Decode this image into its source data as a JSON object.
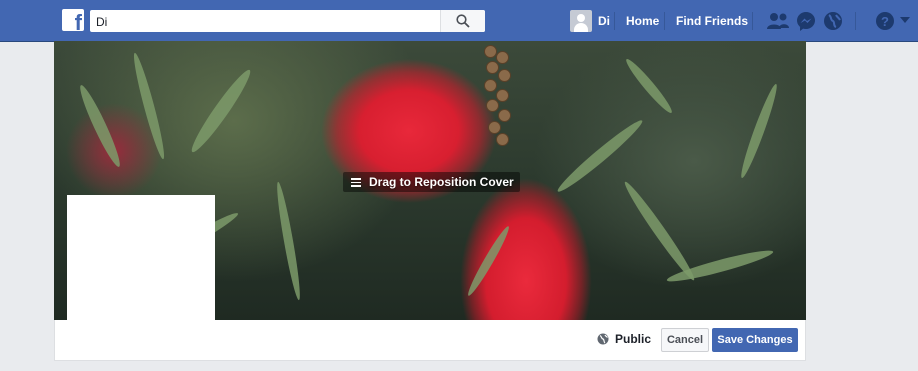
{
  "header": {
    "logo_letter": "f",
    "search": {
      "value": "Di",
      "placeholder": "Search"
    },
    "profile_name": "Di",
    "nav": {
      "home": "Home",
      "find_friends": "Find Friends"
    },
    "icons": [
      "friend-requests-icon",
      "messenger-icon",
      "notifications-globe-icon",
      "help-icon",
      "account-menu-caret-icon"
    ],
    "brand_color": "#4267b2"
  },
  "cover": {
    "drag_label": "Drag to Reposition Cover"
  },
  "footer": {
    "privacy_label": "Public",
    "cancel_label": "Cancel",
    "save_label": "Save Changes"
  }
}
